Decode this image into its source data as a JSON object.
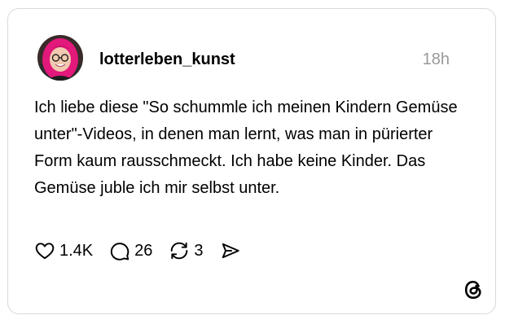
{
  "post": {
    "username": "lotterleben_kunst",
    "timestamp": "18h",
    "text": "Ich liebe diese \"So schummle ich meinen Kindern Gemüse unter\"-Videos, in denen man lernt, was man in pürierter Form kaum rausschmeckt. Ich habe keine Kinder. Das Gemüse juble ich mir selbst unter."
  },
  "actions": {
    "likes": "1.4K",
    "replies": "26",
    "reposts": "3"
  },
  "icons": {
    "like": "heart-icon",
    "reply": "comment-bubble-icon",
    "repost": "repost-icon",
    "share": "send-icon",
    "brand": "threads-logo-icon"
  },
  "colors": {
    "text": "#000000",
    "muted": "#999999",
    "border": "#d9d9d9",
    "avatar_hair": "#e2187a"
  }
}
